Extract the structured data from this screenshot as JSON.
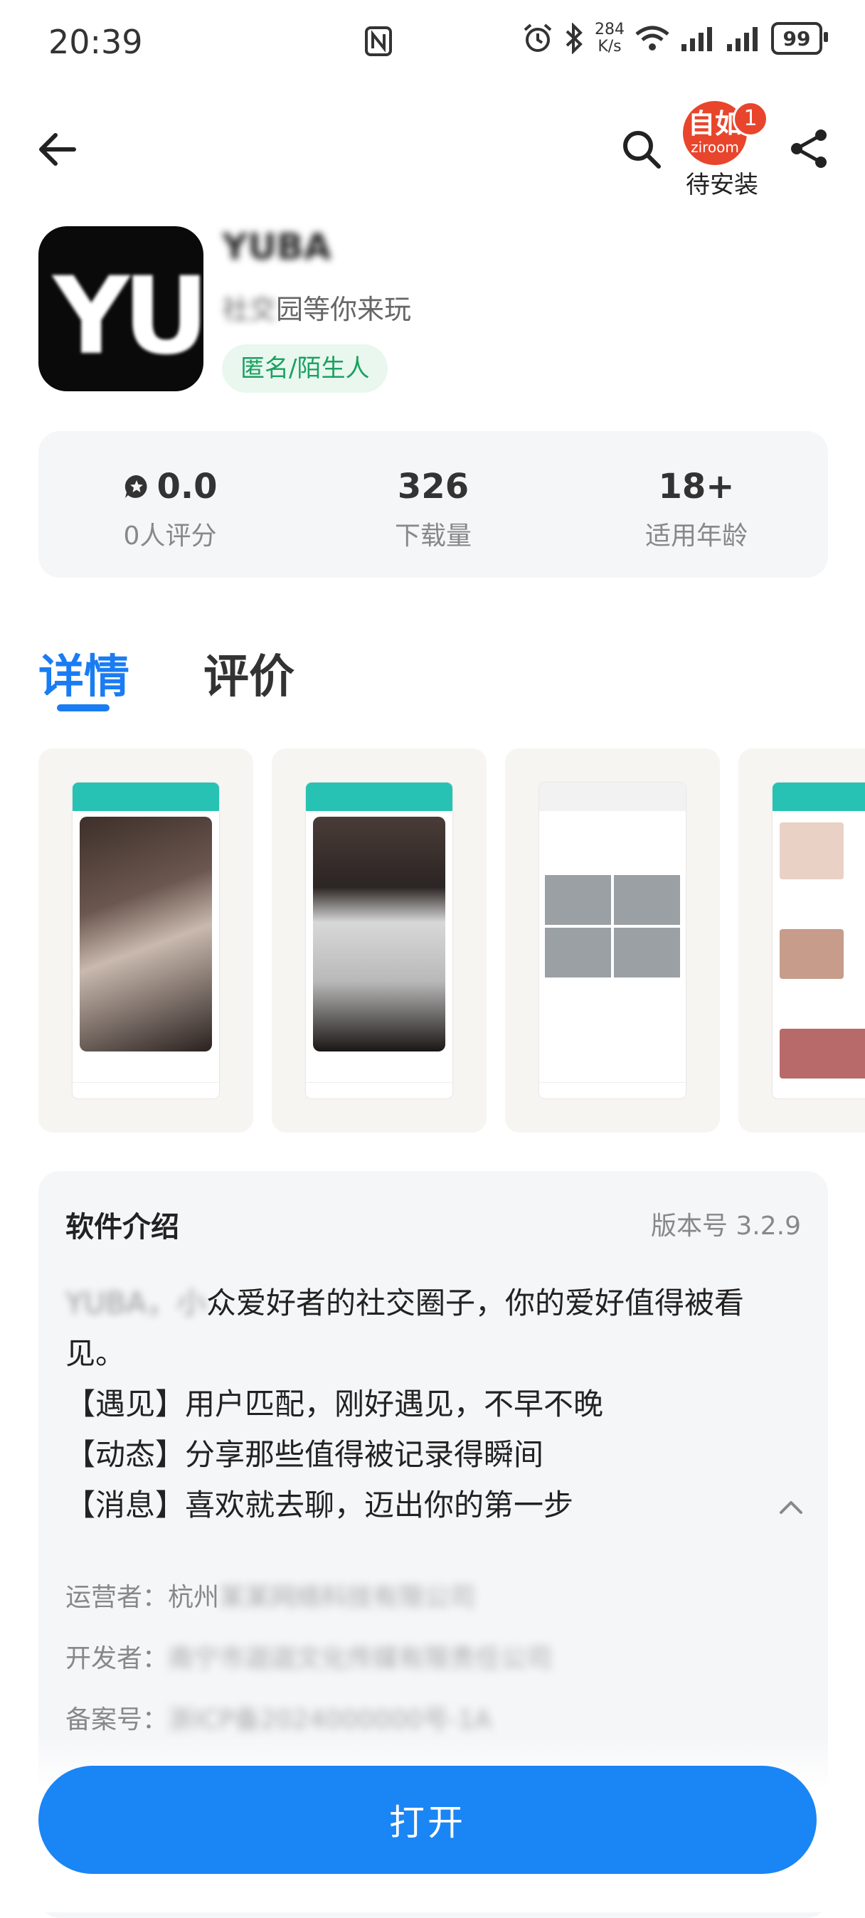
{
  "status_bar": {
    "time": "20:39",
    "speed_value": "284",
    "speed_unit": "K/s",
    "battery": "99"
  },
  "topbar": {
    "ziroom_cn": "自如",
    "ziroom_en": "ziroom",
    "ziroom_badge": "1",
    "pending_label": "待安装"
  },
  "app": {
    "name": "YUBA",
    "slogan_blurred": "社交",
    "slogan_visible": "园等你来玩",
    "tag": "匿名/陌生人",
    "icon_text": "YU"
  },
  "stats": [
    {
      "value": "0.0",
      "label": "0人评分"
    },
    {
      "value": "326",
      "label": "下载量"
    },
    {
      "value": "18+",
      "label": "适用年龄"
    }
  ],
  "tabs": [
    {
      "label": "详情"
    },
    {
      "label": "评价"
    }
  ],
  "intro": {
    "title": "软件介绍",
    "version": "版本号 3.2.9",
    "line1_blur": "YUBA，小",
    "line1": "众爱好者的社交圈子，你的爱好值得被看见。",
    "line2": "【遇见】用户匹配，刚好遇见，不早不晚",
    "line3": "【动态】分享那些值得被记录得瞬间",
    "line4": "【消息】喜欢就去聊，迈出你的第一步",
    "operator_label": "运营者：",
    "operator_prefix": "杭州",
    "operator_blur": "某某网络科技有限公司",
    "developer_label": "开发者：",
    "developer_blur": "南宁市迦迦文化传媒有限责任公司",
    "record_label": "备案号：",
    "record_blur": "浙ICP备2024000000号-1A"
  },
  "open_button": "打开"
}
